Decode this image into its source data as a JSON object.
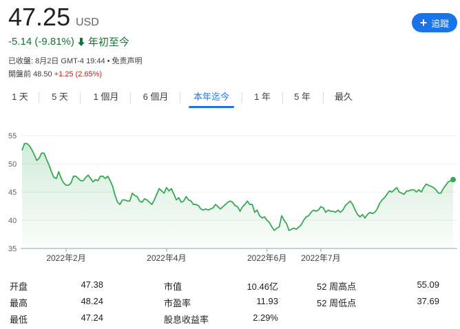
{
  "quote": {
    "price": "47.25",
    "currency": "USD",
    "change": "-5.14 (-9.81%)",
    "period": "年初至今",
    "closed_info": "已收盤: 8月2日 GMT-4 19:44 • 免责声明",
    "premarket_label": "開盤前",
    "premarket_price": "48.50",
    "premarket_change": "+1.25 (2.65%)"
  },
  "follow_button": {
    "label": "追蹤"
  },
  "tabs": [
    {
      "label": "1 天"
    },
    {
      "label": "5 天"
    },
    {
      "label": "1 個月"
    },
    {
      "label": "6 個月"
    },
    {
      "label": "本年迄今",
      "active": true
    },
    {
      "label": "1 年"
    },
    {
      "label": "5 年"
    },
    {
      "label": "最久"
    }
  ],
  "colors": {
    "accent": "#1a73e8",
    "down": "#137333",
    "up": "#c5221f",
    "line": "#34a853"
  },
  "chart_data": {
    "type": "area",
    "ylim": [
      35,
      55
    ],
    "y_ticks": [
      "55",
      "50",
      "45",
      "40",
      "35"
    ],
    "x_ticks": [
      {
        "label": "2022年2月",
        "index": 18
      },
      {
        "label": "2022年4月",
        "index": 59
      },
      {
        "label": "2022年6月",
        "index": 100
      },
      {
        "label": "2022年7月",
        "index": 122
      }
    ],
    "values": [
      52.4,
      53.6,
      53.6,
      53.2,
      52.5,
      51.6,
      50.6,
      51.0,
      51.9,
      51.9,
      50.8,
      49.8,
      48.6,
      47.6,
      47.4,
      48.6,
      47.4,
      46.6,
      46.2,
      46.2,
      46.6,
      47.8,
      47.8,
      47.4,
      47.0,
      47.0,
      47.6,
      48.0,
      47.4,
      46.8,
      47.2,
      47.0,
      47.8,
      47.8,
      47.4,
      47.8,
      47.0,
      46.0,
      44.4,
      43.2,
      42.8,
      43.6,
      43.6,
      43.4,
      43.4,
      44.8,
      44.4,
      44.2,
      43.4,
      43.2,
      43.8,
      43.6,
      43.2,
      42.8,
      43.6,
      44.6,
      45.6,
      45.2,
      44.8,
      45.8,
      45.2,
      45.6,
      44.6,
      43.6,
      44.0,
      43.2,
      43.4,
      44.2,
      43.6,
      43.4,
      42.8,
      42.8,
      42.6,
      42.0,
      41.8,
      42.0,
      41.8,
      42.0,
      42.2,
      42.8,
      42.4,
      42.0,
      42.4,
      42.8,
      43.2,
      43.4,
      43.2,
      42.6,
      42.4,
      41.6,
      42.4,
      42.8,
      43.4,
      42.8,
      42.8,
      41.4,
      41.8,
      40.8,
      40.4,
      40.6,
      40.0,
      39.6,
      38.8,
      38.2,
      38.6,
      38.8,
      40.8,
      40.0,
      39.4,
      38.2,
      38.4,
      38.6,
      38.4,
      38.8,
      39.2,
      40.0,
      40.6,
      40.8,
      41.4,
      41.8,
      41.6,
      41.8,
      42.4,
      42.2,
      41.4,
      41.8,
      41.6,
      41.6,
      41.4,
      41.8,
      41.4,
      41.8,
      42.6,
      43.0,
      43.4,
      42.8,
      41.8,
      41.0,
      40.6,
      41.0,
      40.4,
      41.0,
      41.4,
      41.2,
      41.4,
      42.0,
      43.0,
      43.6,
      44.0,
      44.6,
      45.2,
      45.0,
      45.4,
      45.8,
      45.0,
      44.8,
      44.6,
      45.2,
      45.2,
      45.4,
      45.4,
      45.0,
      45.4,
      45.0,
      45.8,
      46.4,
      46.2,
      46.0,
      45.8,
      45.4,
      44.8,
      44.8,
      45.6,
      46.2,
      46.8,
      47.0,
      47.2
    ]
  },
  "stats": [
    {
      "label": "开盘",
      "value": "47.38"
    },
    {
      "label": "最高",
      "value": "48.24"
    },
    {
      "label": "最低",
      "value": "47.24"
    },
    {
      "label": "市值",
      "value": "10.46亿"
    },
    {
      "label": "市盈率",
      "value": "11.93"
    },
    {
      "label": "股息收益率",
      "value": "2.29%"
    },
    {
      "label": "52 周高点",
      "value": "55.09"
    },
    {
      "label": "52 周低点",
      "value": "37.69"
    }
  ]
}
